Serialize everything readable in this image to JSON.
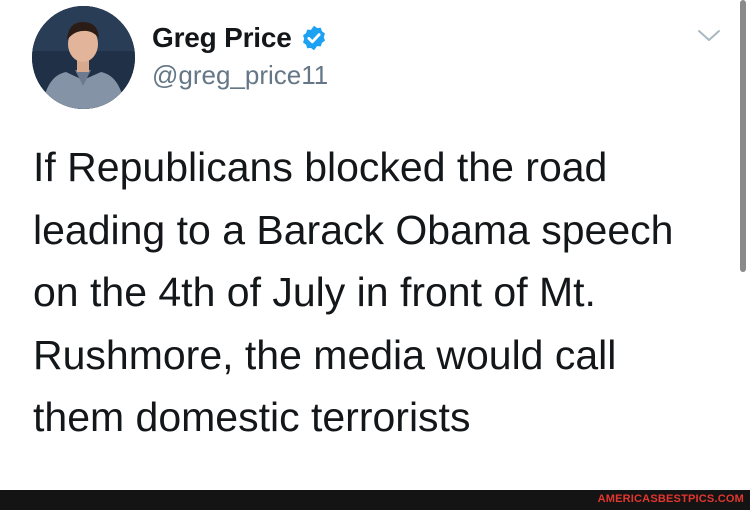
{
  "user": {
    "display_name": "Greg Price",
    "handle": "@greg_price11",
    "verified": true
  },
  "tweet": {
    "lines": [
      "If Republicans blocked the road",
      "leading to a Barack Obama speech",
      "on the 4th of July in front of Mt.",
      "Rushmore, the media would call",
      "them domestic terrorists"
    ]
  },
  "icons": {
    "verified": "verified-badge-icon",
    "menu": "chevron-down-icon"
  },
  "colors": {
    "verified_blue": "#1da1f2",
    "handle_gray": "#657786",
    "watermark_red": "#e2362e"
  },
  "watermark": "AMERICASBESTPICS.COM"
}
